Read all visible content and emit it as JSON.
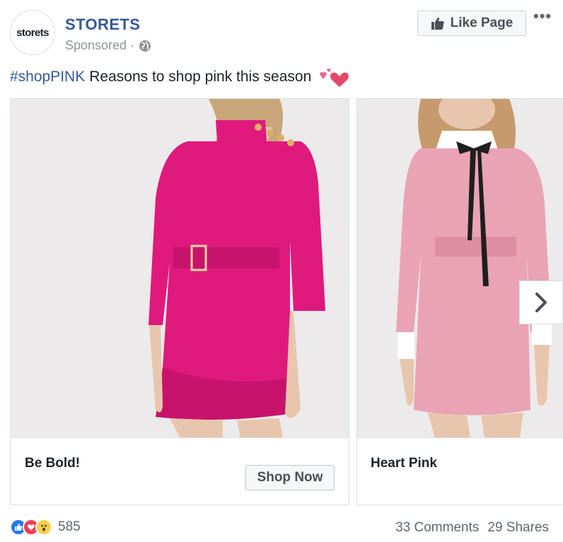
{
  "post": {
    "page_logo_text": "storets",
    "page_name": "STORETS",
    "sponsored_label": "Sponsored ·",
    "like_page_label": "Like Page",
    "more_label": "•••",
    "caption_tag": "#shopPINK",
    "caption_text": "Reasons to shop pink this season"
  },
  "carousel": {
    "cards": [
      {
        "title": "Be Bold!",
        "cta": "Shop Now",
        "dress_color": "#e0197d"
      },
      {
        "title": "Heart Pink",
        "dress_color": "#e9a3b5"
      }
    ]
  },
  "footer": {
    "reaction_icons": [
      "like-icon",
      "love-icon",
      "wow-icon"
    ],
    "reaction_count": "585",
    "comments": "33 Comments",
    "shares": "29 Shares"
  },
  "colors": {
    "link_blue": "#365899",
    "meta_gray": "#90949c",
    "like_blue": "#2078f4",
    "love_red": "#f33e58",
    "wow_yellow": "#fbd04f"
  }
}
